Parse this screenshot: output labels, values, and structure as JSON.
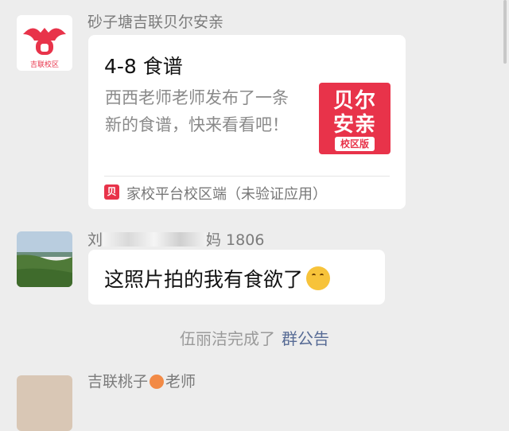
{
  "messages": [
    {
      "sender": "砂子塘吉联贝尔安亲",
      "avatar_caption": "吉联校区",
      "avatar_icon": "school-logo-icon",
      "card": {
        "title": "4-8 食谱",
        "description": "西西老师老师发布了一条新的食谱，快来看看吧！",
        "thumbnail_line1": "贝尔",
        "thumbnail_line2": "安亲",
        "thumbnail_badge": "校区版",
        "source_icon_glyph": "贝",
        "source": "家校平台校区端（未验证应用）"
      }
    },
    {
      "sender_prefix": "刘",
      "sender_suffix": "妈 1806",
      "text": "这照片拍的我有食欲了",
      "emoji": "thinking-face-icon"
    }
  ],
  "system_notice": {
    "text": "伍丽洁完成了",
    "link": "群公告"
  },
  "next_message": {
    "sender_prefix": "吉联桃子",
    "sender_suffix": "老师"
  },
  "colors": {
    "background": "#ededed",
    "bubble": "#ffffff",
    "brand_red": "#e8334a",
    "link": "#576b95"
  }
}
